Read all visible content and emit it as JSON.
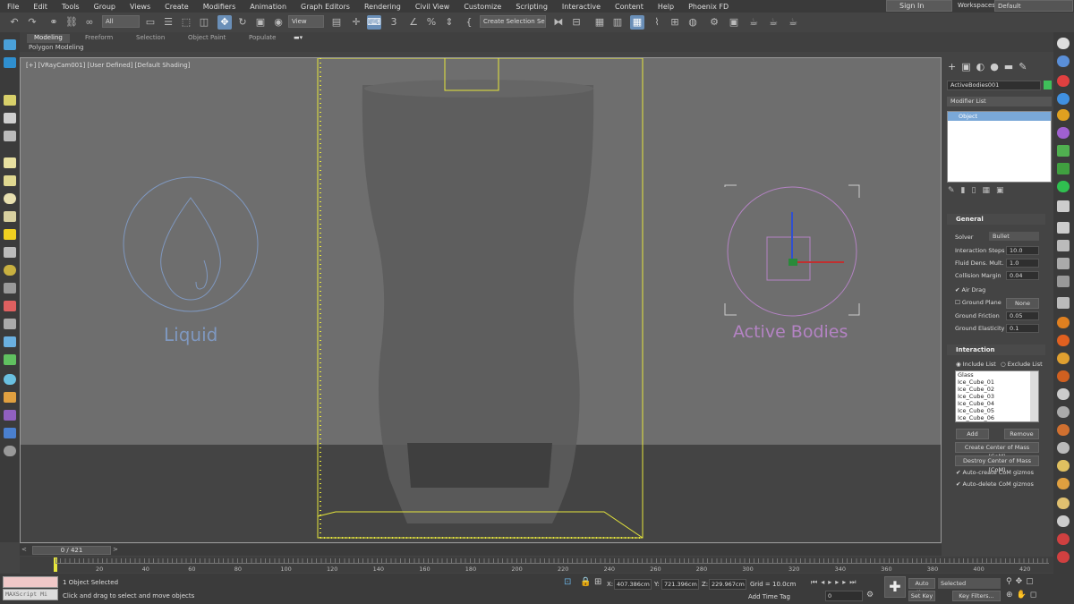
{
  "menu": [
    "File",
    "Edit",
    "Tools",
    "Group",
    "Views",
    "Create",
    "Modifiers",
    "Animation",
    "Graph Editors",
    "Rendering",
    "Civil View",
    "Customize",
    "Scripting",
    "Interactive",
    "Content",
    "Help",
    "Phoenix FD"
  ],
  "account": {
    "sign_in": "Sign In",
    "workspaces_label": "Workspaces:",
    "workspace_value": "Default"
  },
  "toolbar": {
    "filter_value": "All",
    "ref_coord_value": "View",
    "selection_set_placeholder": "Create Selection Se"
  },
  "ribbon": {
    "tabs": [
      "Modeling",
      "Freeform",
      "Selection",
      "Object Paint",
      "Populate"
    ],
    "subtitle": "Polygon Modeling"
  },
  "viewport": {
    "label": "[+] [VRayCam001] [User Defined] [Default Shading]",
    "liquid_label": "Liquid",
    "active_bodies_label": "Active Bodies"
  },
  "command_panel": {
    "object_name": "ActiveBodies001",
    "object_color": "#3fbf5a",
    "modifier_list_label": "Modifier List",
    "stack_item": "Object",
    "general": {
      "title": "General",
      "solver_label": "Solver",
      "solver_value": "Bullet",
      "interaction_steps_label": "Interaction Steps",
      "interaction_steps_value": "10.0",
      "fluid_dens_label": "Fluid Dens. Mult.",
      "fluid_dens_value": "1.0",
      "collision_margin_label": "Collision Margin",
      "collision_margin_value": "0.04",
      "air_drag_label": "Air Drag",
      "ground_plane_label": "Ground Plane",
      "ground_plane_value": "None",
      "ground_friction_label": "Ground Friction",
      "ground_friction_value": "0.05",
      "ground_elasticity_label": "Ground Elasticity",
      "ground_elasticity_value": "0.1"
    },
    "interaction": {
      "title": "Interaction",
      "include_list_label": "Include List",
      "exclude_list_label": "Exclude List",
      "items": [
        "Glass",
        "Ice_Cube_01",
        "Ice_Cube_02",
        "Ice_Cube_03",
        "Ice_Cube_04",
        "Ice_Cube_05",
        "Ice_Cube_06"
      ],
      "add_label": "Add",
      "remove_label": "Remove",
      "create_com_label": "Create Center of Mass (CoM)",
      "destroy_com_label": "Destroy Center of Mass (CoM)",
      "auto_create_label": "Auto-create CoM gizmos",
      "auto_delete_label": "Auto-delete CoM gizmos"
    }
  },
  "timeline": {
    "slider_text": "0 / 421",
    "ticks": [
      "20",
      "40",
      "60",
      "80",
      "100",
      "120",
      "140",
      "160",
      "180",
      "200",
      "220",
      "240",
      "260",
      "280",
      "300",
      "320",
      "340",
      "360",
      "380",
      "400",
      "420"
    ]
  },
  "status": {
    "selection_text": "1 Object Selected",
    "prompt_text": "Click and drag to select and move objects",
    "maxscript_placeholder": "MAXScript Mi",
    "x_label": "X:",
    "x_value": "407.386cm",
    "y_label": "Y:",
    "y_value": "721.396cm",
    "z_label": "Z:",
    "z_value": "229.967cm",
    "grid_text": "Grid = 10.0cm",
    "add_time_tag": "Add Time Tag",
    "auto_key": "Auto Key",
    "set_key": "Set Key",
    "key_mode_value": "Selected",
    "key_filters": "Key Filters...",
    "frame_value": "0"
  }
}
